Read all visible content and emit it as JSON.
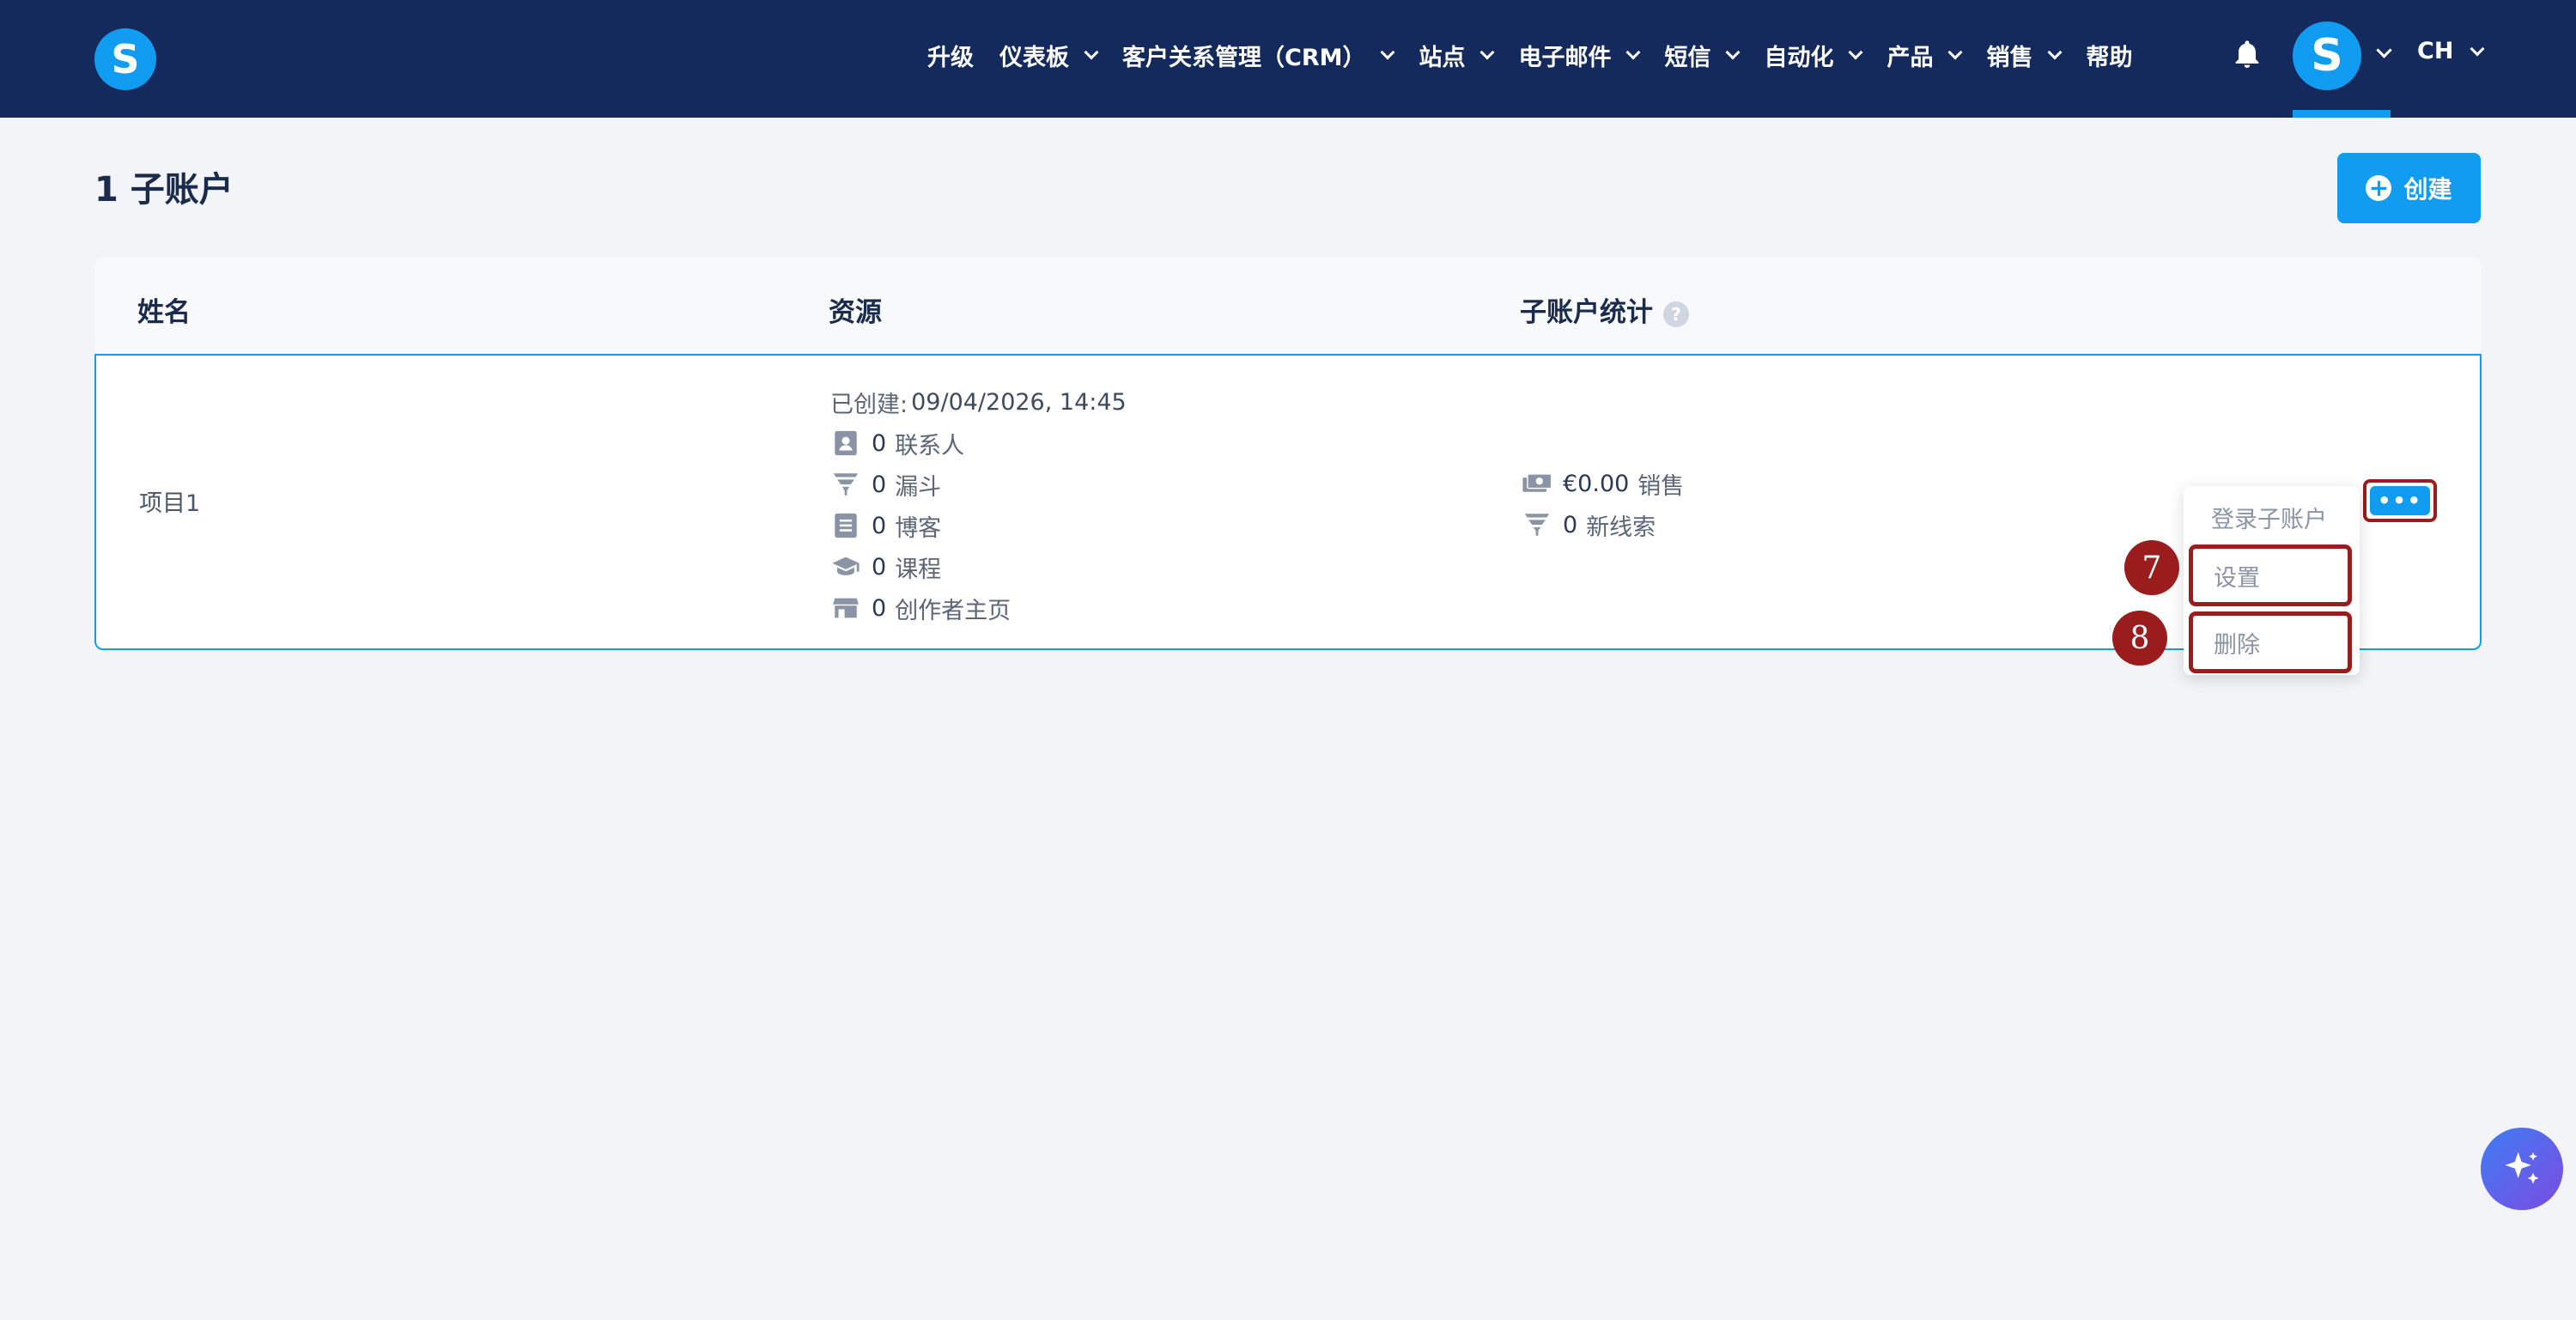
{
  "brand": {
    "logo_letter": "S"
  },
  "nav": {
    "items": [
      {
        "label": "升级",
        "dropdown": false
      },
      {
        "label": "仪表板",
        "dropdown": true
      },
      {
        "label": "客户关系管理（CRM）",
        "dropdown": true
      },
      {
        "label": "站点",
        "dropdown": true
      },
      {
        "label": "电子邮件",
        "dropdown": true
      },
      {
        "label": "短信",
        "dropdown": true
      },
      {
        "label": "自动化",
        "dropdown": true
      },
      {
        "label": "产品",
        "dropdown": true
      },
      {
        "label": "销售",
        "dropdown": true
      },
      {
        "label": "帮助",
        "dropdown": false
      }
    ],
    "avatar_letter": "S",
    "language": "CH"
  },
  "page": {
    "title": "1 子账户",
    "create_label": "创建"
  },
  "table": {
    "headers": {
      "name": "姓名",
      "resources": "资源",
      "stats": "子账户统计",
      "stats_help": "?"
    },
    "row": {
      "name": "项目1",
      "created_label": "已创建:",
      "created_value": "09/04/2026, 14:45",
      "resources": [
        {
          "icon": "contact-icon",
          "count": "0",
          "label": "联系人"
        },
        {
          "icon": "funnel-icon",
          "count": "0",
          "label": "漏斗"
        },
        {
          "icon": "blog-icon",
          "count": "0",
          "label": "博客"
        },
        {
          "icon": "course-icon",
          "count": "0",
          "label": "课程"
        },
        {
          "icon": "store-icon",
          "count": "0",
          "label": "创作者主页"
        }
      ],
      "stats": [
        {
          "icon": "money-icon",
          "count": "€0.00",
          "label": "销售"
        },
        {
          "icon": "funnel-icon",
          "count": "0",
          "label": "新线索"
        }
      ],
      "more_label": "•••"
    }
  },
  "dropdown_menu": {
    "items": [
      "登录子账户",
      "设置",
      "删除"
    ]
  },
  "annotations": {
    "badge_settings": "7",
    "badge_delete": "8"
  },
  "colors": {
    "nav_bg": "#142a5c",
    "accent": "#109cf1",
    "highlight": "#9b1c1c",
    "page_bg": "#f2f4f7"
  }
}
